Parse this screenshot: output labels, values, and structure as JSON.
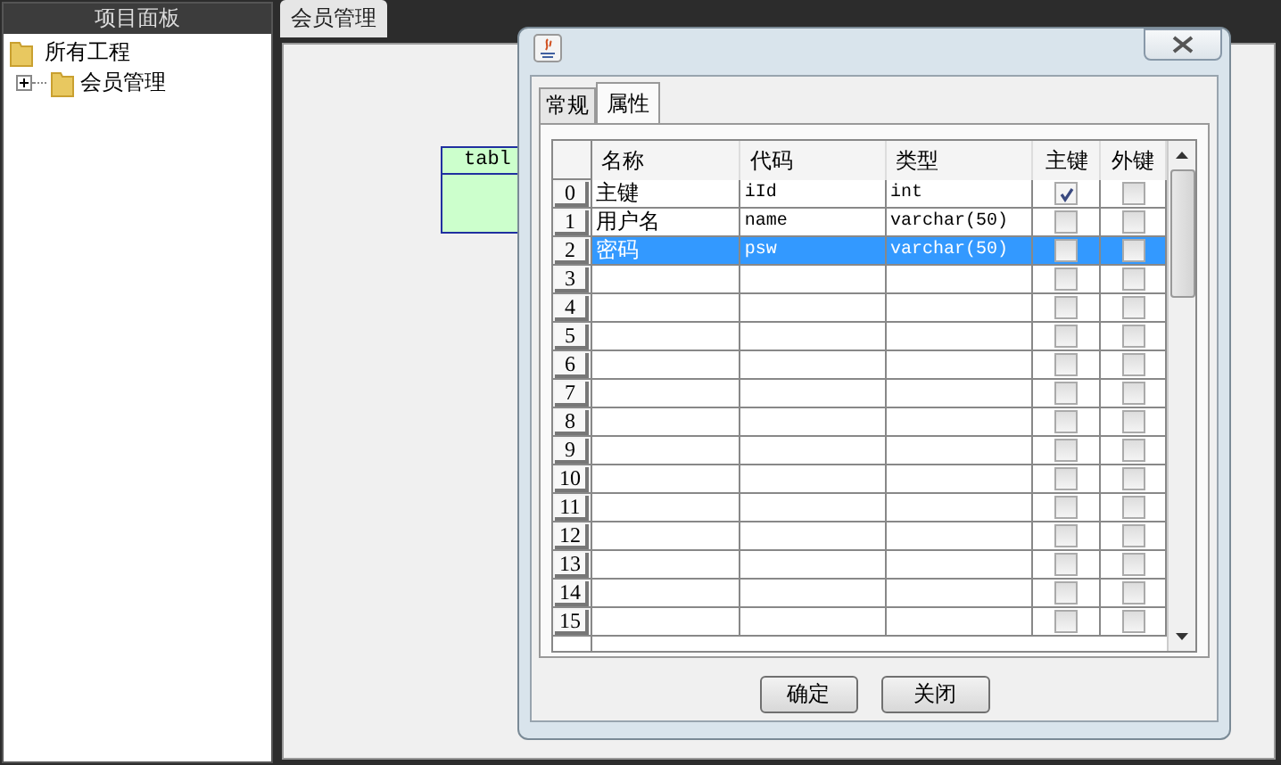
{
  "sidebar": {
    "title": "项目面板",
    "tree": [
      {
        "label": "所有工程",
        "children": [
          {
            "label": "会员管理",
            "expanded": false
          }
        ]
      }
    ]
  },
  "editor_tabs": [
    {
      "label": "会员管理",
      "selected": true
    }
  ],
  "canvas": {
    "entity": {
      "title": "tabl"
    }
  },
  "dialog": {
    "tabs": [
      {
        "label": "常规",
        "selected": false
      },
      {
        "label": "属性",
        "selected": true
      }
    ],
    "columns": [
      "名称",
      "代码",
      "类型",
      "主键",
      "外键"
    ],
    "rows": [
      {
        "index": "0",
        "name": "主键",
        "code": "iId",
        "type": "int",
        "primary_key": true,
        "foreign_key": false,
        "selected": false
      },
      {
        "index": "1",
        "name": "用户名",
        "code": "name",
        "type": "varchar(50)",
        "primary_key": false,
        "foreign_key": false,
        "selected": false
      },
      {
        "index": "2",
        "name": "密码",
        "code": "psw",
        "type": "varchar(50)",
        "primary_key": false,
        "foreign_key": false,
        "selected": true
      },
      {
        "index": "3",
        "primary_key": false,
        "foreign_key": false,
        "selected": false
      },
      {
        "index": "4",
        "primary_key": false,
        "foreign_key": false,
        "selected": false
      },
      {
        "index": "5",
        "primary_key": false,
        "foreign_key": false,
        "selected": false
      },
      {
        "index": "6",
        "primary_key": false,
        "foreign_key": false,
        "selected": false
      },
      {
        "index": "7",
        "primary_key": false,
        "foreign_key": false,
        "selected": false
      },
      {
        "index": "8",
        "primary_key": false,
        "foreign_key": false,
        "selected": false
      },
      {
        "index": "9",
        "primary_key": false,
        "foreign_key": false,
        "selected": false
      },
      {
        "index": "10",
        "primary_key": false,
        "foreign_key": false,
        "selected": false
      },
      {
        "index": "11",
        "primary_key": false,
        "foreign_key": false,
        "selected": false
      },
      {
        "index": "12",
        "primary_key": false,
        "foreign_key": false,
        "selected": false
      },
      {
        "index": "13",
        "primary_key": false,
        "foreign_key": false,
        "selected": false
      },
      {
        "index": "14",
        "primary_key": false,
        "foreign_key": false,
        "selected": false
      },
      {
        "index": "15",
        "primary_key": false,
        "foreign_key": false,
        "selected": false
      }
    ],
    "buttons": [
      "确定",
      "关闭"
    ]
  }
}
